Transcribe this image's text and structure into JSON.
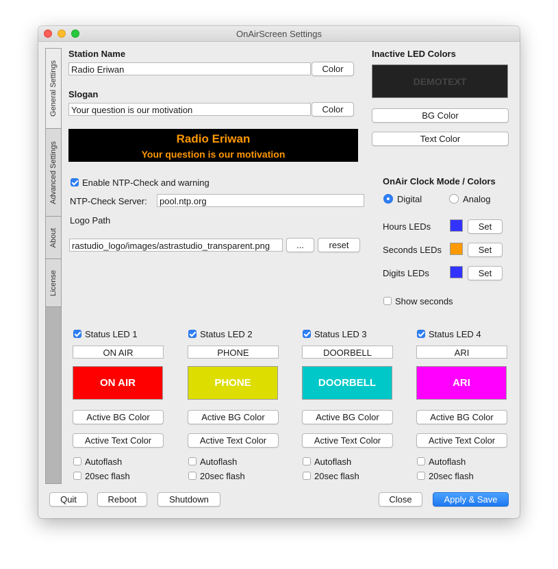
{
  "window": {
    "title": "OnAirScreen Settings"
  },
  "tabs": [
    {
      "label": "General Settings"
    },
    {
      "label": "Advanced Settings"
    },
    {
      "label": "About"
    },
    {
      "label": "License"
    }
  ],
  "station": {
    "name_label": "Station Name",
    "name_value": "Radio Eriwan",
    "slogan_label": "Slogan",
    "slogan_value": "Your question is our motivation",
    "color_button": "Color"
  },
  "preview": {
    "name": "Radio Eriwan",
    "slogan": "Your question is our motivation",
    "bg": "#000000",
    "text_color": "#ff9800"
  },
  "inactive_led": {
    "label": "Inactive LED Colors",
    "demo_text": "DEMOTEXT",
    "bg_button": "BG Color",
    "text_button": "Text Color"
  },
  "ntp": {
    "enable_label": "Enable NTP-Check and warning",
    "enabled": true,
    "server_label": "NTP-Check Server:",
    "server_value": "pool.ntp.org"
  },
  "logo": {
    "label": "Logo Path",
    "path_value": "rastudio_logo/images/astrastudio_transparent.png",
    "browse_button": "...",
    "reset_button": "reset"
  },
  "clock": {
    "label": "OnAir Clock Mode / Colors",
    "digital_label": "Digital",
    "analog_label": "Analog",
    "mode": "Digital",
    "hours_label": "Hours LEDs",
    "seconds_label": "Seconds LEDs",
    "digits_label": "Digits LEDs",
    "set_button": "Set",
    "hours_color": "#3333ff",
    "seconds_color": "#ff9900",
    "digits_color": "#3333ff",
    "show_seconds_label": "Show seconds"
  },
  "status_leds": [
    {
      "label": "Status LED 1",
      "enabled": true,
      "text": "ON AIR",
      "bg": "#ff0000",
      "fg": "#ffffff"
    },
    {
      "label": "Status LED 2",
      "enabled": true,
      "text": "PHONE",
      "bg": "#dddd00",
      "fg": "#ffffff"
    },
    {
      "label": "Status LED 3",
      "enabled": true,
      "text": "DOORBELL",
      "bg": "#00c8c8",
      "fg": "#ffffff"
    },
    {
      "label": "Status LED 4",
      "enabled": true,
      "text": "ARI",
      "bg": "#ff00ff",
      "fg": "#ffffff"
    }
  ],
  "led_buttons": {
    "active_bg": "Active BG Color",
    "active_text": "Active Text Color",
    "autoflash": "Autoflash",
    "flash20": "20sec flash"
  },
  "footer": {
    "quit": "Quit",
    "reboot": "Reboot",
    "shutdown": "Shutdown",
    "close": "Close",
    "apply": "Apply & Save"
  }
}
